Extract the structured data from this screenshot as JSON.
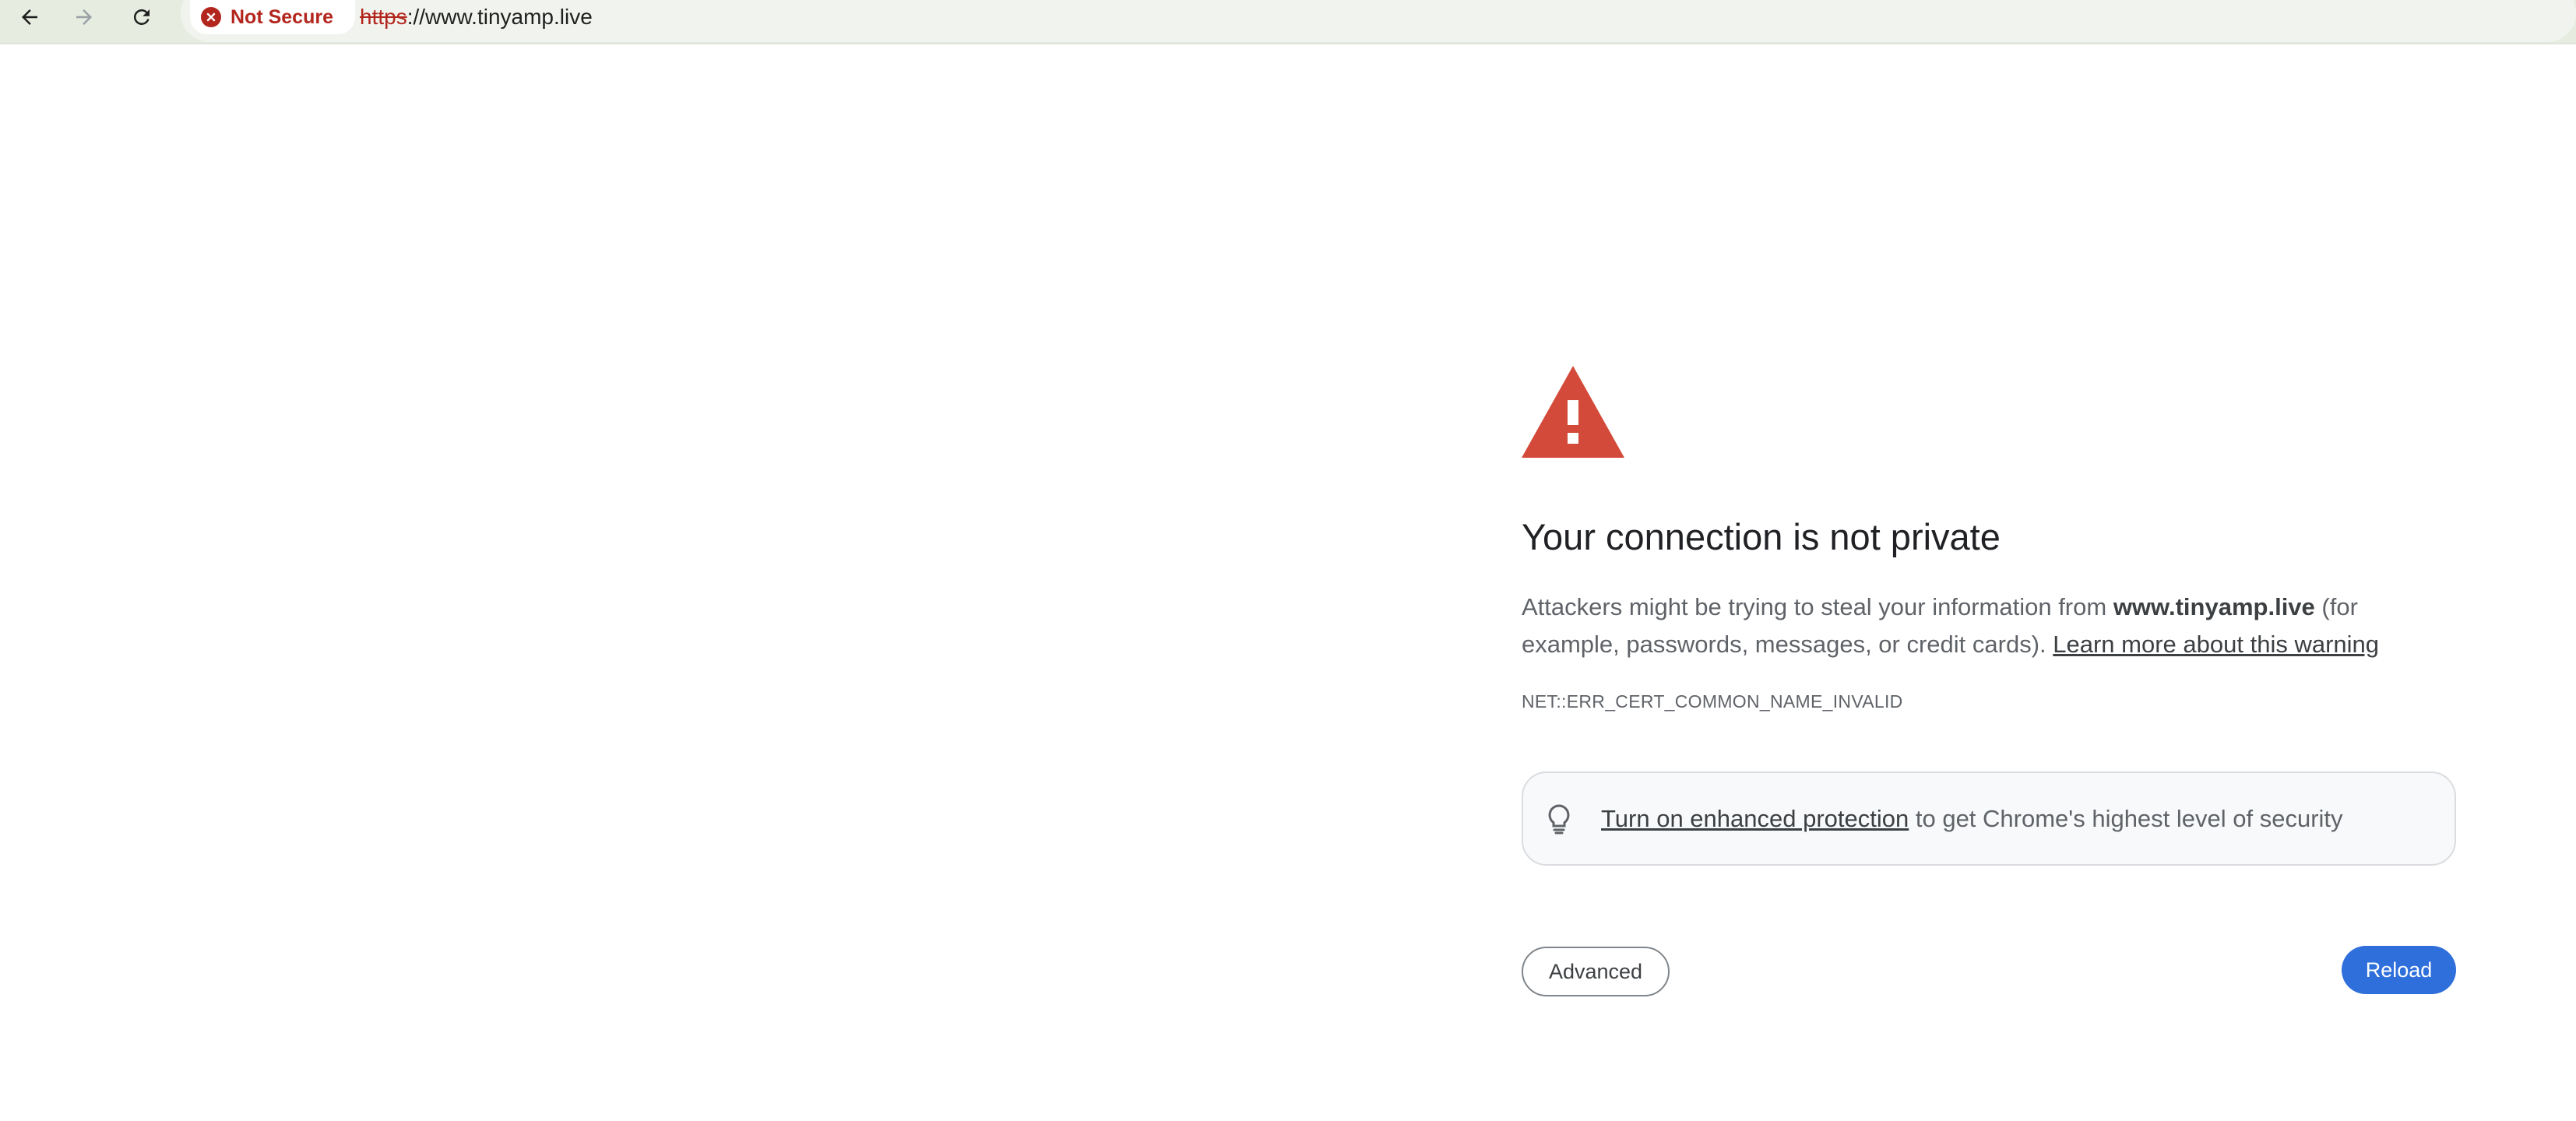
{
  "toolbar": {
    "back_label": "Back",
    "forward_label": "Forward",
    "reload_label": "Reload page",
    "security_chip": "Not Secure",
    "url_scheme": "https",
    "url_rest": "://www.tinyamp.live"
  },
  "interstitial": {
    "title": "Your connection is not private",
    "desc_prefix": "Attackers might be trying to steal your information from ",
    "desc_domain": "www.tinyamp.live",
    "desc_suffix": " (for example, passwords, messages, or credit cards). ",
    "learn_more": "Learn more about this warning",
    "error_code": "NET::ERR_CERT_COMMON_NAME_INVALID",
    "protection_link": "Turn on enhanced protection",
    "protection_suffix": " to get Chrome's highest level of security",
    "advanced_button": "Advanced",
    "reload_button": "Reload"
  },
  "icons": {
    "warning": "warning-triangle-icon",
    "bulb": "lightbulb-icon",
    "error": "error-circle-icon"
  },
  "colors": {
    "toolbar_bg": "#e6ecdf",
    "danger": "#b3261e",
    "warning_triangle": "#d34a3a",
    "primary_button": "#2f6fdb"
  }
}
